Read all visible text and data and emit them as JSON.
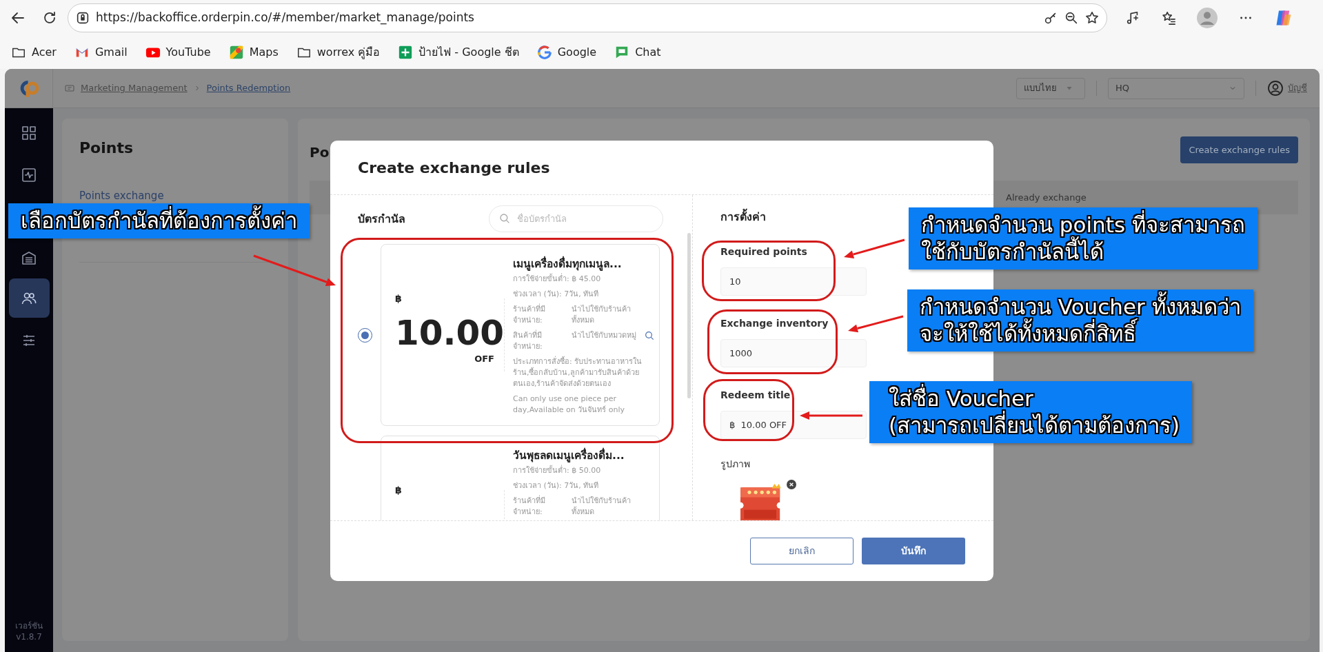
{
  "browser": {
    "url": "https://backoffice.orderpin.co/#/member/market_manage/points",
    "bookmarks": [
      {
        "label": "Acer",
        "kind": "folder"
      },
      {
        "label": "Gmail",
        "kind": "gmail"
      },
      {
        "label": "YouTube",
        "kind": "youtube"
      },
      {
        "label": "Maps",
        "kind": "maps"
      },
      {
        "label": "worrex คู่มือ",
        "kind": "folder"
      },
      {
        "label": "ป้ายไฟ - Google ชีต",
        "kind": "sheets"
      },
      {
        "label": "Google",
        "kind": "google"
      },
      {
        "label": "Chat",
        "kind": "chat"
      }
    ]
  },
  "header": {
    "breadcrumb": [
      "Marketing Management",
      "Points Redemption"
    ],
    "language": "แบบไทย",
    "branch": "HQ",
    "account": "บัญชี"
  },
  "sidebar": {
    "items": [
      {
        "kind": "grid",
        "selected": false
      },
      {
        "kind": "activity",
        "selected": false
      },
      {
        "kind": "building",
        "selected": false
      },
      {
        "kind": "users",
        "selected": true
      },
      {
        "kind": "sliders",
        "selected": false
      }
    ],
    "version_label": "เวอร์ชัน",
    "version": "v1.8.7"
  },
  "points_panel": {
    "title": "Points",
    "items": [
      {
        "label": "Points exchange",
        "selected": true
      }
    ]
  },
  "main": {
    "title": "Po",
    "create_button": "Create exchange rules",
    "columns": [
      "Already exchange"
    ]
  },
  "modal": {
    "title": "Create exchange rules",
    "coupon_label": "บัตรกำนัล",
    "search_placeholder": "ชื่อบัตรกำนัล",
    "vouchers": [
      {
        "selected": true,
        "currency": "฿",
        "amount": "10.00",
        "suffix": "OFF",
        "title": "เมนูเครื่องดื่มทุกเมนูล...",
        "min_spend": "การใช้จ่ายขั้นต่ำ: ฿ 45.00",
        "period": "ช่วงเวลา (วัน): 7วัน, ทันที",
        "rows": [
          {
            "label": "ร้านค้าที่มีจำหน่าย:",
            "value": "นำไปใช้กับร้านค้าทั้งหมด",
            "searchable": false
          },
          {
            "label": "สินค้าที่มีจำหน่าย:",
            "value": "นำไปใช้กับหมวดหมู่",
            "searchable": true
          }
        ],
        "order_type": "ประเภทการสั่งซื้อ: รับประทานอาหารในร้าน,ซื้อกลับบ้าน,ลูกค้ามารับสินค้าด้วยตนเอง,ร้านค้าจัดส่งด้วยตนเอง",
        "note": "Can only use one piece per day,Available on วันจันทร์ only"
      },
      {
        "currency": "฿",
        "title": "วันพุธลดเมนูเครื่องดื่ม...",
        "min_spend": "การใช้จ่ายขั้นต่ำ: ฿ 50.00",
        "period": "ช่วงเวลา (วัน): 7วัน, ทันที",
        "rows": [
          {
            "label": "ร้านค้าที่มีจำหน่าย:",
            "value": "นำไปใช้กับร้านค้าทั้งหมด",
            "searchable": false
          }
        ]
      }
    ],
    "settings_title": "การตั้งค่า",
    "fields": [
      {
        "label": "Required points",
        "value": "10"
      },
      {
        "label": "Exchange inventory",
        "value": "1000"
      },
      {
        "label": "Redeem title",
        "value": "฿  10.00 OFF"
      }
    ],
    "image_label": "รูปภาพ",
    "buttons": [
      {
        "label": "ยกเลิก",
        "kind": "secondary"
      },
      {
        "label": "บันทึก",
        "kind": "primary"
      }
    ]
  },
  "annotations": [
    {
      "text": "เลือกบัตรกำนัลที่ต้องการตั้งค่า"
    },
    {
      "text": "กำหนดจำนวน points ที่จะสามารถ\nใช้กับบัตรกำนัลนี้ได้"
    },
    {
      "text": "กำหนดจำนวน Voucher ทั้งหมดว่า\nจะให้ใช้ได้ทั้งหมดกี่สิทธิ์"
    },
    {
      "text": "ใส่ชื่อ Voucher\n(สามารถเปลี่ยนได้ตามต้องการ)"
    }
  ]
}
